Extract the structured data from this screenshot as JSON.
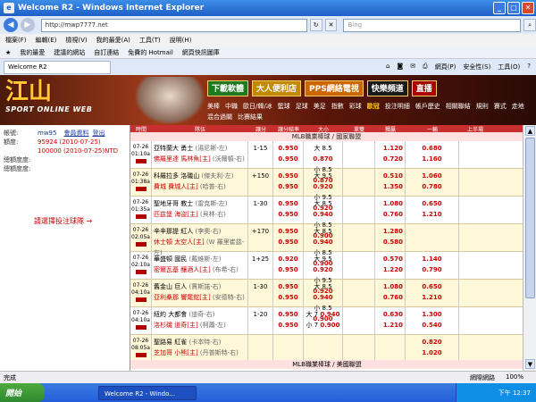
{
  "window": {
    "title": "Welcome R2 - Windows Internet Explorer"
  },
  "address": {
    "url": "http://mwp7777.net",
    "search_placeholder": "Bing"
  },
  "menu": [
    "檔案(F)",
    "編輯(E)",
    "檢視(V)",
    "我的最愛(A)",
    "工具(T)",
    "說明(H)"
  ],
  "favorites": [
    "我的最愛",
    "建議的網站",
    "自訂連結",
    "免費的 Hotmail",
    "網頁快訊圖庫"
  ],
  "tab": {
    "label": "Welcome R2"
  },
  "tools": [
    "網頁(P)",
    "安全性(S)",
    "工具(O)"
  ],
  "site": {
    "logo_cn": "江山",
    "logo_en": "SPORT ONLINE WEB",
    "banners": [
      "下載軟體",
      "大人便利店",
      "PPS網絡電視",
      "快樂頻道",
      "直播"
    ],
    "nav": [
      "美棒",
      "中職",
      "歐日/韓/冰",
      "籃球",
      "足球",
      "美足",
      "指數",
      "彩球",
      "歐冠",
      "投注明細",
      "帳戶歷史",
      "相關聯結",
      "規則",
      "賽式",
      "走地",
      "混合過關",
      "比賽結果"
    ],
    "nav_highlight": "歐冠"
  },
  "sidebar": {
    "account_label": "帳號:",
    "account": "mw95",
    "member_link": "會員資料",
    "logout_link": "登出",
    "credit_label": "額度:",
    "credit": "95924 (2010-07-25)",
    "credit2": "100000 (2010-07-25)NTD",
    "bet_label1": "總額度度:",
    "bet_label2": "總額度度:",
    "hint": "請選擇投注球隊 →"
  },
  "table": {
    "headers": [
      "時間",
      "隊伍",
      "讓分",
      "讓分賠率",
      "大小",
      "大小賠率",
      "單雙",
      "獨贏",
      "一輸",
      "",
      "上半場"
    ],
    "league1": "MLB職業棒球 / 國家聯盟",
    "league2": "MLB職業棒球 / 美國聯盟",
    "games": [
      {
        "date": "07-26",
        "time": "01:10a",
        "away": "亞特蘭大 勇士",
        "away_p": "(湯尼斯-左)",
        "home": "佛羅里達 馬林魚[主]",
        "home_p": "(沃爾頓-右)",
        "hcp": "1-15",
        "odd1": "0.950",
        "odd2": "0.950",
        "ou1": "大 8.5",
        "ou1v": "0.870",
        "ou2": "小 8.5",
        "ou2v": "0.870",
        "oe1": "",
        "oe2": "",
        "ml1": "1.120",
        "ml2": "0.720",
        "ht1": "0.680",
        "ht2": "1.160"
      },
      {
        "date": "07-26",
        "time": "01:38a",
        "away": "科羅拉多 洛磯山",
        "away_p": "(傑夫利-左)",
        "home": "費城 費城人[主]",
        "home_p": "(哈普-右)",
        "hcp": "+150",
        "odd1": "0.950",
        "odd2": "0.950",
        "ou1": "大 9.5",
        "ou1v": "0.920",
        "ou2": "小 9.5",
        "ou2v": "0.920",
        "oe1": "",
        "oe2": "",
        "ml1": "0.510",
        "ml2": "1.350",
        "ht1": "1.060",
        "ht2": "0.780"
      },
      {
        "date": "07-26",
        "time": "01:35a",
        "away": "聖地牙哥 教士",
        "away_p": "(雷克斯-左)",
        "home": "匹茲堡 海盜[主]",
        "home_p": "(貝林-右)",
        "hcp": "1-30",
        "odd1": "0.950",
        "odd2": "0.950",
        "ou1": "大 8.5",
        "ou1v": "0.940",
        "ou2": "小 8.5",
        "ou2v": "0.900",
        "oe1": "",
        "oe2": "",
        "ml1": "1.080",
        "ml2": "0.760",
        "ht1": "0.650",
        "ht2": "1.210"
      },
      {
        "date": "07-26",
        "time": "02:05a",
        "away": "辛辛那提 紅人",
        "away_p": "(李奧-右)",
        "home": "休士頓 太空人[主]",
        "home_p": "(W 羅里崔茲-左)",
        "hcp": "+170",
        "odd1": "0.950",
        "odd2": "0.950",
        "ou1": "大 8.5",
        "ou1v": "0.940",
        "ou2": "小 8.5",
        "ou2v": "0.900",
        "oe1": "",
        "oe2": "",
        "ml1": "1.280",
        "ml2": "0.580",
        "ht1": "",
        "ht2": ""
      },
      {
        "date": "07-26",
        "time": "02:10a",
        "away": "華盛頓 國民",
        "away_p": "(戴維斯-左)",
        "home": "密爾瓦基 釀酒人[主]",
        "home_p": "(布希-右)",
        "hcp": "1+25",
        "odd1": "0.920",
        "odd2": "0.950",
        "ou1": "大 9.5",
        "ou1v": "0.920",
        "ou2": "小 9.5",
        "ou2v": "0.920",
        "oe1": "",
        "oe2": "",
        "ml1": "0.570",
        "ml2": "1.220",
        "ht1": "1.140",
        "ht2": "0.790"
      },
      {
        "date": "07-26",
        "time": "04:10a",
        "away": "舊金山 巨人",
        "away_p": "(賈斯諾-右)",
        "home": "亞利桑那 響尾蛇[主]",
        "home_p": "(安德特-右)",
        "hcp": "1-30",
        "odd1": "0.950",
        "odd2": "0.950",
        "ou1": "大 8.5",
        "ou1v": "0.940",
        "ou2": "小 8.5",
        "ou2v": "0.900",
        "oe1": "",
        "oe2": "",
        "ml1": "1.080",
        "ml2": "0.760",
        "ht1": "0.650",
        "ht2": "1.210"
      },
      {
        "date": "07-26",
        "time": "04:10a",
        "away": "紐約 大都會",
        "away_p": "(迪奇-右)",
        "home": "洛杉磯 道奇[主]",
        "home_p": "(柯蕭-左)",
        "hcp": "1-20",
        "odd1": "0.950",
        "odd2": "0.950",
        "ou1": "大 7",
        "ou1v": "0.940",
        "ou2": "小 7",
        "ou2v": "0.900",
        "oe1": "",
        "oe2": "",
        "ml1": "0.630",
        "ml2": "1.210",
        "ht1": "1.300",
        "ht2": "0.540"
      },
      {
        "date": "07-26",
        "time": "08:05a",
        "away": "聖路易 紅雀",
        "away_p": "(卡本特-右)",
        "home": "芝加哥 小熊[主]",
        "home_p": "(丹普斯特-右)",
        "hcp": "",
        "odd1": "",
        "odd2": "",
        "ou1": "",
        "ou1v": "",
        "ou2": "",
        "ou2v": "",
        "oe1": "",
        "oe2": "",
        "ml1": "",
        "ml2": "",
        "ht1": "0.820",
        "ht2": "1.020"
      }
    ]
  },
  "status": {
    "left": "完成",
    "zone": "網際網路",
    "zoom": "100%"
  },
  "taskbar": {
    "start": "開始",
    "task": "Welcome R2 - Windo...",
    "clock": "下午 12:37"
  }
}
